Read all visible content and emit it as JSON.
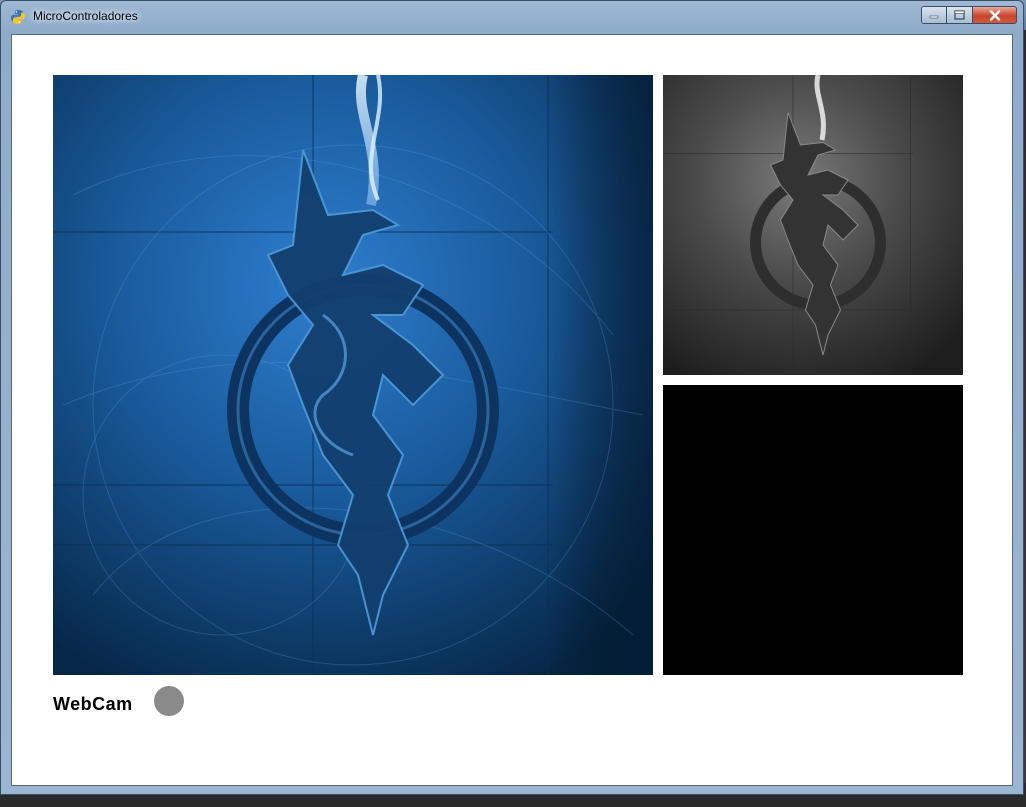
{
  "window": {
    "title": "MicroControladores",
    "icon": "python-snake-icon"
  },
  "controls": {
    "minimize": "minimize-icon",
    "maximize": "maximize-icon",
    "close": "close-icon"
  },
  "views": {
    "main_image": "dragon-emblem-blue",
    "gray_image": "dragon-emblem-grayscale",
    "black_panel": "empty-black-panel"
  },
  "webcam": {
    "label": "WebCam",
    "status_color": "#8a8a8a"
  }
}
